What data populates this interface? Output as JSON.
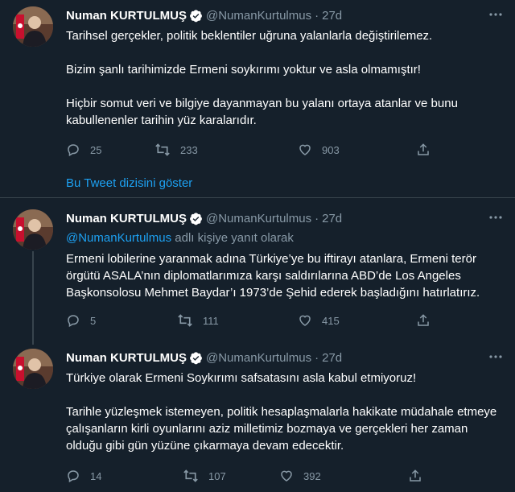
{
  "colors": {
    "background": "#15202b",
    "text_primary": "#ffffff",
    "text_secondary": "#8899a6",
    "accent": "#1da1f2",
    "divider": "#38444d"
  },
  "tweets": [
    {
      "name": "Numan KURTULMUŞ",
      "handle": "@NumanKurtulmus",
      "dot": "·",
      "time": "27d",
      "paragraphs": [
        "Tarihsel gerçekler, politik beklentiler uğruna yalanlarla değiştirilemez.",
        "Bizim şanlı tarihimizde Ermeni soykırımı yoktur ve asla olmamıştır!",
        "Hiçbir somut veri ve bilgiye dayanmayan bu yalanı ortaya atanlar ve bunu kabullenenler tarihin yüz karalarıdır."
      ],
      "replies": "25",
      "retweets": "233",
      "likes": "903"
    },
    {
      "name": "Numan KURTULMUŞ",
      "handle": "@NumanKurtulmus",
      "dot": "·",
      "time": "27d",
      "reply_to_mention": "@NumanKurtulmus",
      "reply_to_suffix": " adlı kişiye yanıt olarak",
      "paragraphs": [
        "Ermeni lobilerine yaranmak adına Türkiye’ye bu iftirayı atanlara, Ermeni terör örgütü ASALA’nın diplomatlarımıza karşı saldırılarına ABD’de Los Angeles Başkonsolosu Mehmet Baydar’ı 1973’de Şehid ederek başladığını hatırlatırız."
      ],
      "replies": "5",
      "retweets": "111",
      "likes": "415"
    },
    {
      "name": "Numan KURTULMUŞ",
      "handle": "@NumanKurtulmus",
      "dot": "·",
      "time": "27d",
      "paragraphs": [
        "Türkiye olarak Ermeni Soykırımı safsatasını asla kabul etmiyoruz!",
        "Tarihle yüzleşmek istemeyen, politik hesaplaşmalarla hakikate müdahale etmeye çalışanların kirli oyunlarını aziz milletimiz bozmaya ve gerçekleri her zaman olduğu gibi gün yüzüne çıkarmaya devam edecektir."
      ],
      "replies": "14",
      "retweets": "107",
      "likes": "392"
    }
  ],
  "show_thread": "Bu Tweet dizisini göster",
  "icons": [
    "verified-icon",
    "more-icon",
    "reply-icon",
    "retweet-icon",
    "like-icon",
    "share-icon"
  ]
}
